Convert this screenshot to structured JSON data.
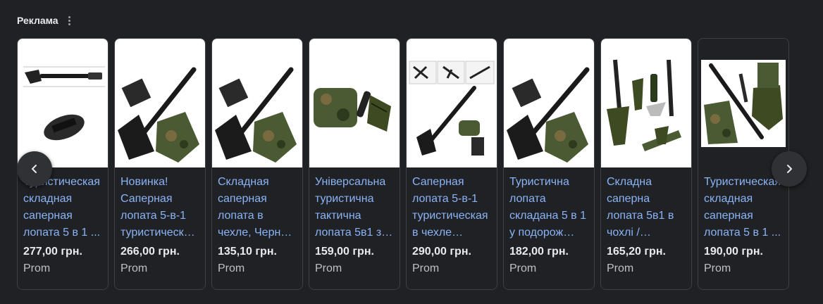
{
  "header": {
    "label": "Реклама"
  },
  "cards": [
    {
      "title": "Туристическая складная саперная лопата 5 в 1 ...",
      "price": "277,00 грн.",
      "store": "Prom"
    },
    {
      "title": "Новинка! Саперная лопата 5-в-1 туристическ…",
      "price": "266,00 грн.",
      "store": "Prom"
    },
    {
      "title": "Складная саперная лопата в чехле, Черн…",
      "price": "135,10 грн.",
      "store": "Prom"
    },
    {
      "title": "Універсальна туристична тактична лопата 5в1 з…",
      "price": "159,00 грн.",
      "store": "Prom"
    },
    {
      "title": "Саперная лопата 5-в-1 туристическая в чехле…",
      "price": "290,00 грн.",
      "store": "Prom"
    },
    {
      "title": "Туристична лопата складана 5 в 1 у подорож…",
      "price": "182,00 грн.",
      "store": "Prom"
    },
    {
      "title": "Складна саперна лопата 5в1 в чохлі /…",
      "price": "165,20 грн.",
      "store": "Prom"
    },
    {
      "title": "Туристическая складная саперная лопата 5 в 1 ...",
      "price": "190,00 грн.",
      "store": "Prom"
    }
  ],
  "colors": {
    "background": "#202124",
    "link": "#8ab4f8",
    "price": "#e8eaed",
    "store": "#bdc1c6",
    "camo_green": "#4a5a32",
    "olive": "#3d4a22"
  },
  "icons": {
    "more": "more-vert-icon",
    "prev": "chevron-left-icon",
    "next": "chevron-right-icon"
  }
}
